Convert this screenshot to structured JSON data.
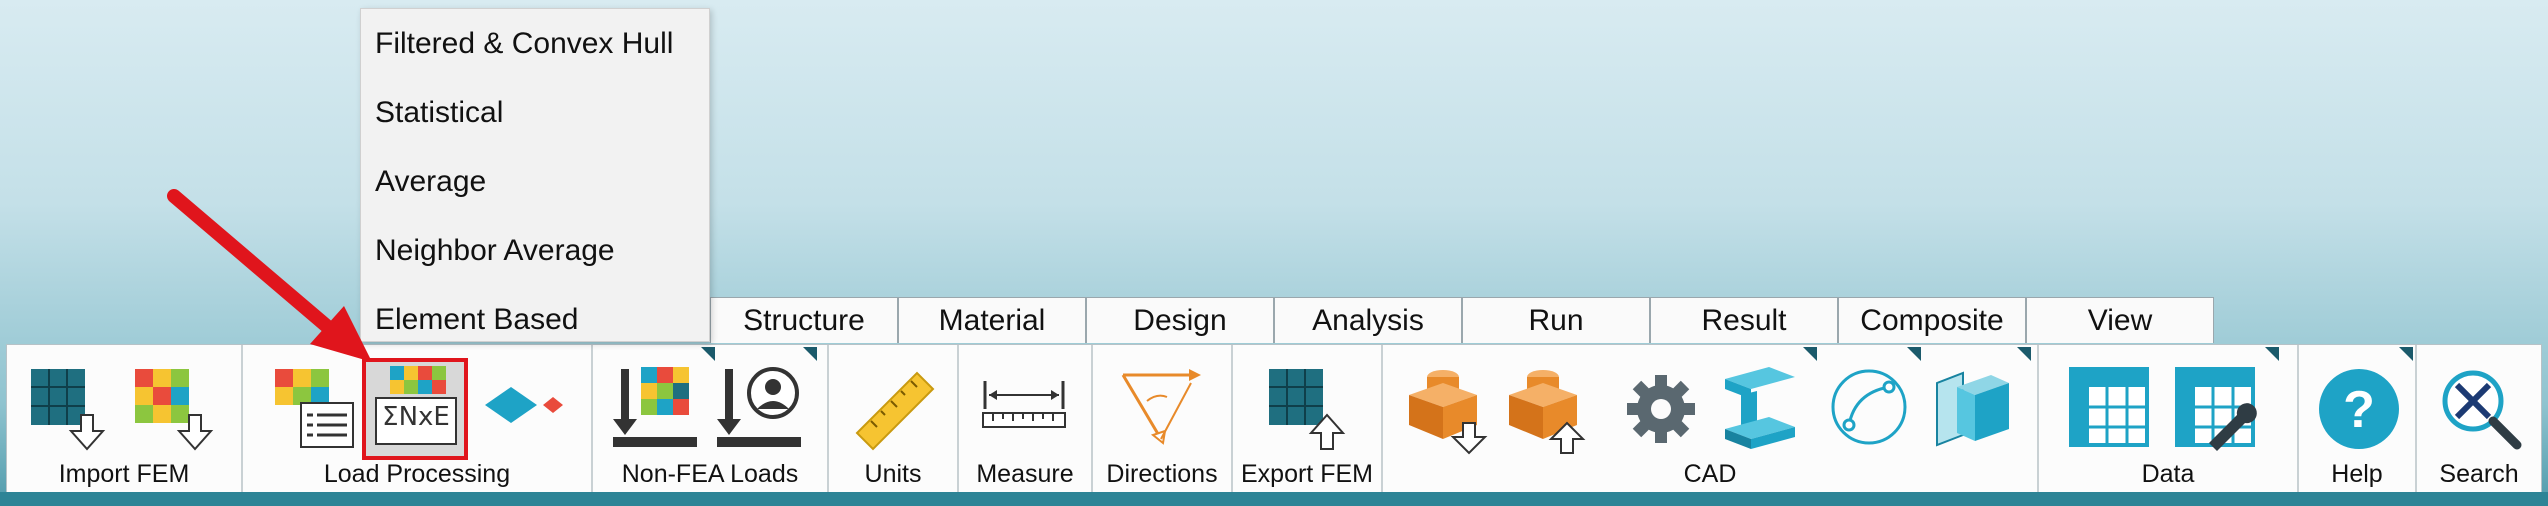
{
  "tabs": [
    {
      "label": "Structure"
    },
    {
      "label": "Material"
    },
    {
      "label": "Design"
    },
    {
      "label": "Analysis"
    },
    {
      "label": "Run"
    },
    {
      "label": "Result"
    },
    {
      "label": "Composite"
    },
    {
      "label": "View"
    }
  ],
  "menu": {
    "items": [
      {
        "label": "Filtered & Convex Hull"
      },
      {
        "label": "Statistical"
      },
      {
        "label": "Average"
      },
      {
        "label": "Neighbor Average"
      },
      {
        "label": "Element Based"
      }
    ]
  },
  "ribbon": {
    "groups": [
      {
        "label": "Import FEM"
      },
      {
        "label": "Load Processing"
      },
      {
        "label": "Non-FEA Loads"
      },
      {
        "label": "Units"
      },
      {
        "label": "Measure"
      },
      {
        "label": "Directions"
      },
      {
        "label": "Export FEM"
      },
      {
        "label": "CAD"
      },
      {
        "label": "Data"
      },
      {
        "label": "Help"
      },
      {
        "label": "Search"
      }
    ]
  },
  "colors": {
    "accent": "#1ea3c6",
    "highlight": "#e0151c",
    "cad_orange": "#e88a2a",
    "ribbon_strip": "#2d8496"
  },
  "icons": {
    "sum_symbol_text": "ΣNxE"
  }
}
